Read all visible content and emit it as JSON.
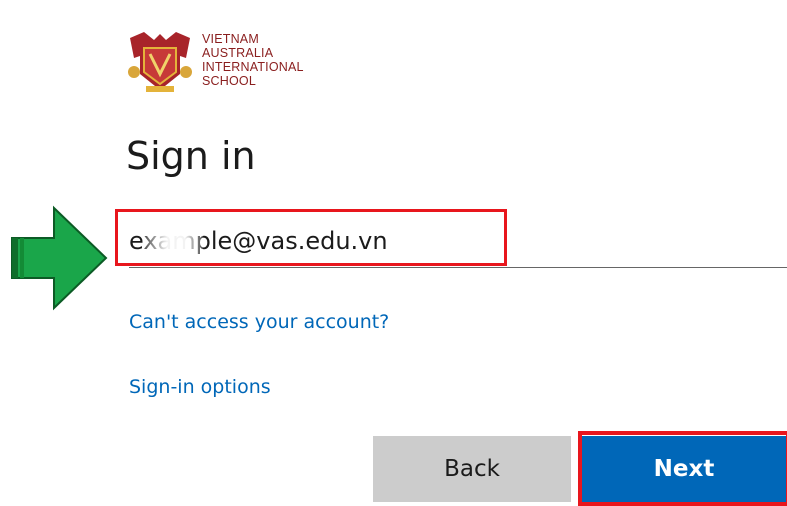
{
  "logo": {
    "lines": [
      "VIETNAM",
      "AUSTRALIA",
      "INTERNATIONAL",
      "SCHOOL"
    ]
  },
  "signin": {
    "title": "Sign in",
    "email_value": "example@vas.edu.vn",
    "cant_access_link": "Can't access your account?",
    "signin_options_link": "Sign-in options",
    "back_button": "Back",
    "next_button": "Next"
  },
  "colors": {
    "accent": "#0067b8",
    "highlight": "#e8161d",
    "arrow": "#1aa64a",
    "logo_red": "#8a1e1e"
  }
}
